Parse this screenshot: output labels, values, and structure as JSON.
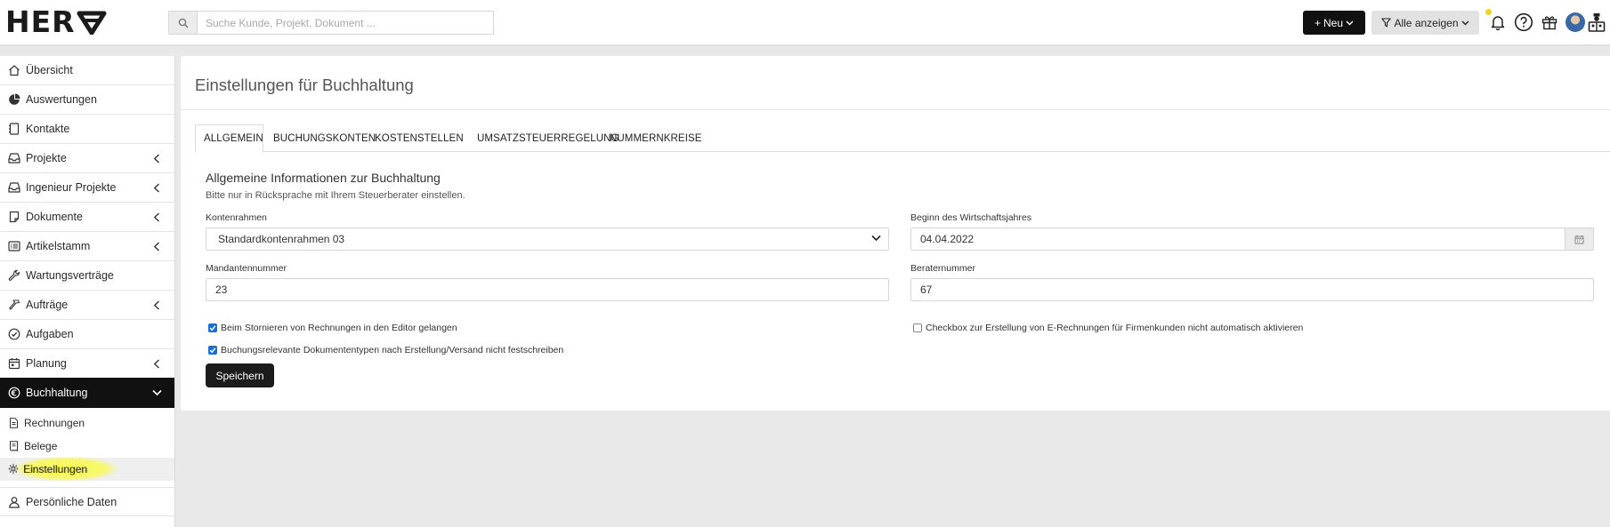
{
  "app": {
    "logo_text": "HER"
  },
  "header": {
    "search_placeholder": "Suche Kunde, Projekt, Dokument ...",
    "new_label": "Neu",
    "filter_label": "Alle anzeigen"
  },
  "sidebar": {
    "items": [
      {
        "label": "Übersicht",
        "icon": "home-icon",
        "has_chevron": false
      },
      {
        "label": "Auswertungen",
        "icon": "pie-chart-icon",
        "has_chevron": false
      },
      {
        "label": "Kontakte",
        "icon": "address-book-icon",
        "has_chevron": false
      },
      {
        "label": "Projekte",
        "icon": "inbox-icon",
        "has_chevron": true
      },
      {
        "label": "Ingenieur Projekte",
        "icon": "inbox-icon",
        "has_chevron": true
      },
      {
        "label": "Dokumente",
        "icon": "document-icon",
        "has_chevron": true
      },
      {
        "label": "Artikelstamm",
        "icon": "list-icon",
        "has_chevron": true
      },
      {
        "label": "Wartungsverträge",
        "icon": "wrench-icon",
        "has_chevron": false
      },
      {
        "label": "Aufträge",
        "icon": "hammer-icon",
        "has_chevron": true
      },
      {
        "label": "Aufgaben",
        "icon": "check-circle-icon",
        "has_chevron": false
      },
      {
        "label": "Planung",
        "icon": "calendar-icon",
        "has_chevron": true
      },
      {
        "label": "Buchhaltung",
        "icon": "euro-icon",
        "has_chevron": true,
        "active": true
      }
    ],
    "subitems": [
      {
        "label": "Rechnungen",
        "icon": "invoice-icon"
      },
      {
        "label": "Belege",
        "icon": "receipt-icon"
      },
      {
        "label": "Einstellungen",
        "icon": "gear-icon",
        "current": true
      }
    ],
    "personal_label": "Persönliche Daten"
  },
  "page": {
    "title": "Einstellungen für Buchhaltung",
    "tabs": [
      "ALLGEMEIN",
      "BUCHUNGSKONTEN",
      "KOSTENSTELLEN",
      "UMSATZSTEUERREGELUNG",
      "NUMMERNKREISE"
    ],
    "section_title": "Allgemeine Informationen zur Buchhaltung",
    "section_note": "Bitte nur in Rücksprache mit Ihrem Steuerberater einstellen.",
    "fields": {
      "kontenrahmen_label": "Kontenrahmen",
      "kontenrahmen_value": "Standardkontenrahmen 03",
      "beginn_label": "Beginn des Wirtschaftsjahres",
      "beginn_value": "04.04.2022",
      "mandant_label": "Mandantennummer",
      "mandant_value": "23",
      "berater_label": "Beraternummer",
      "berater_value": "67"
    },
    "checkboxes": {
      "storno_label": "Beim Stornieren von Rechnungen in den Editor gelangen",
      "storno_checked": true,
      "festschreiben_label": "Buchungsrelevante Dokumententypen nach Erstellung/Versand nicht festschreiben",
      "festschreiben_checked": true,
      "erechnung_label": "Checkbox zur Erstellung von E-Rechnungen für Firmenkunden nicht automatisch aktivieren",
      "erechnung_checked": false
    },
    "save_label": "Speichern"
  },
  "colors": {
    "accent_dark": "#111111",
    "notification_dot": "#f6d31a",
    "highlight": "#fafa3c"
  }
}
